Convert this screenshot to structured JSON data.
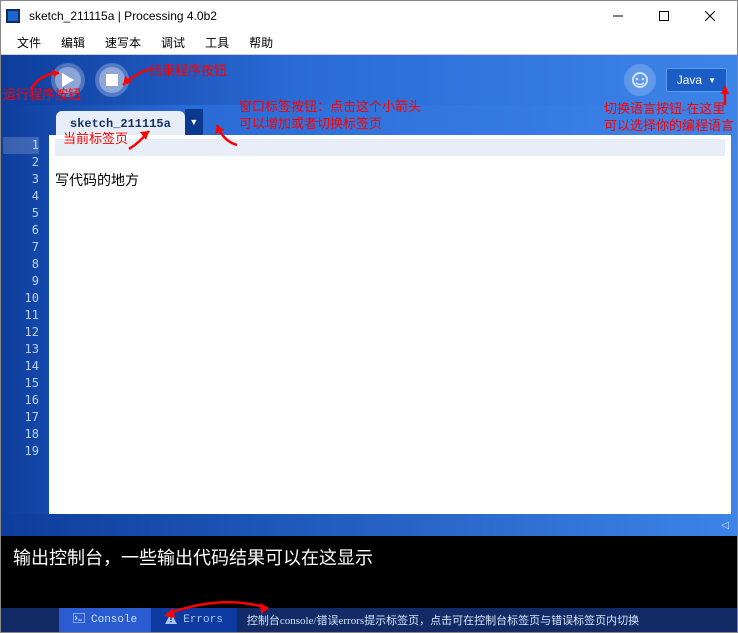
{
  "window": {
    "title": "sketch_211115a | Processing 4.0b2"
  },
  "menu": {
    "file": "文件",
    "edit": "编辑",
    "sketch": "速写本",
    "debug": "调试",
    "tools": "工具",
    "help": "帮助"
  },
  "toolbar": {
    "language_label": "Java",
    "language_caret": "▼"
  },
  "tabs": {
    "active": "sketch_211115a",
    "drop_caret": "▼"
  },
  "editor": {
    "line_count": 19,
    "content_placeholder": "写代码的地方"
  },
  "splitter": {
    "glyph": "◁"
  },
  "console": {
    "placeholder": "输出控制台，一些输出代码结果可以在这显示"
  },
  "bottom": {
    "console_label": "Console",
    "errors_label": "Errors",
    "hint": "控制台console/错误errors提示标签页，点击可在控制台标签页与错误标签页内切换"
  },
  "annotations": {
    "run": "运行程序按钮",
    "stop": "结束程序按钮",
    "tab_drop": "窗口标签按钮：点击这个小箭头可以增加或者切换标签页",
    "current_tab": "当前标签页",
    "lang_line1": "切换语言按钮-在这里",
    "lang_line2": "可以选择你的编程语言"
  }
}
